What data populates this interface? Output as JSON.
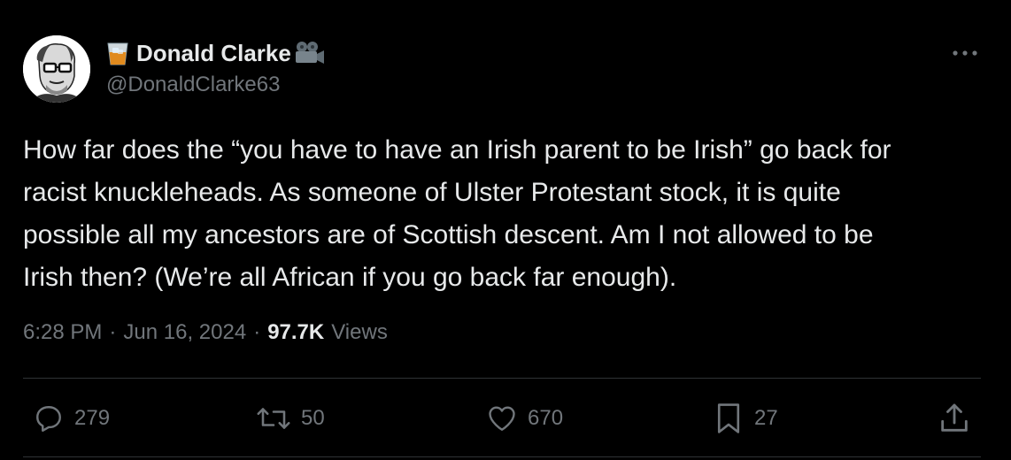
{
  "author": {
    "display_name": "Donald Clarke",
    "handle": "@DonaldClarke63",
    "prefix_emoji": "tumbler-glass-icon",
    "suffix_emoji": "movie-camera-icon"
  },
  "tweet": {
    "text": "How far does the “you have to have an Irish parent to be Irish” go back for\nracist knuckleheads. As someone of Ulster Protestant stock, it is quite\npossible all my ancestors are of Scottish descent. Am I not allowed to be\nIrish then? (We’re all African if you go back far enough).",
    "time": "6:28 PM",
    "date": "Jun 16, 2024",
    "separator": "·",
    "views_count": "97.7K",
    "views_label": "Views"
  },
  "actions": {
    "replies": "279",
    "reposts": "50",
    "likes": "670",
    "bookmarks": "27"
  },
  "colors": {
    "background": "#000000",
    "text_primary": "#e7e9ea",
    "text_secondary": "#71767b",
    "divider": "#2f3336"
  }
}
